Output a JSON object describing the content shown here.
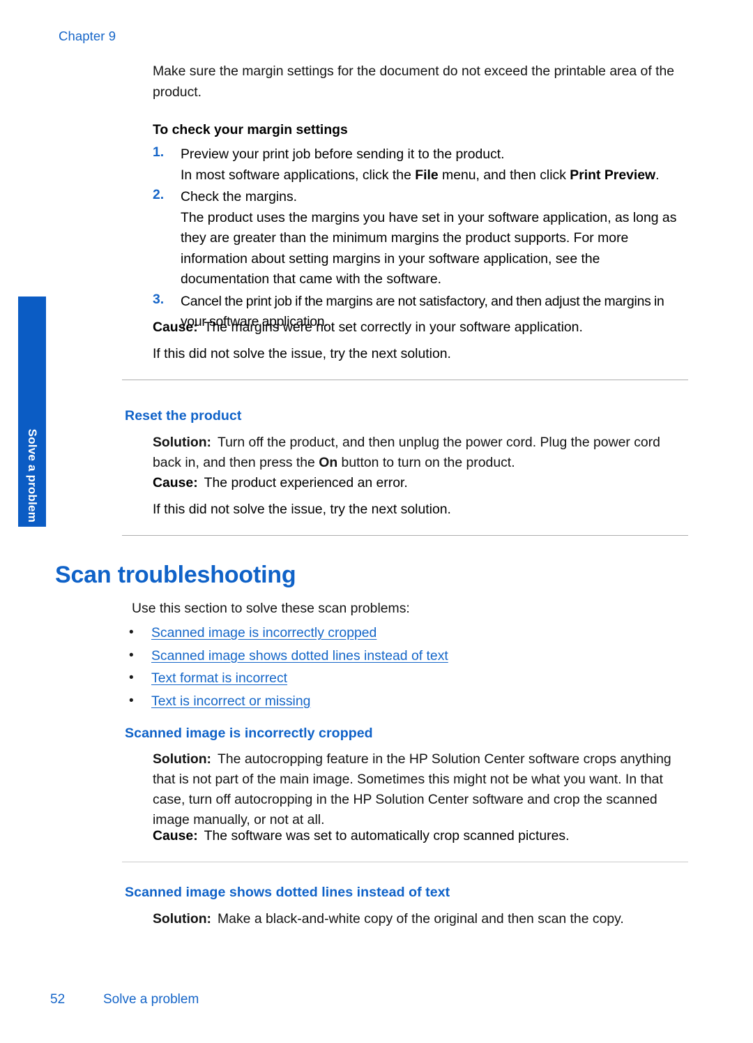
{
  "header": {
    "chapter_label": "Chapter 9"
  },
  "side_tab": {
    "label": "Solve a problem",
    "background_color": "#0B5CC4",
    "text_color": "#FFFFFF"
  },
  "colors": {
    "link_blue": "#1466C8",
    "heading_blue": "#0F62C8",
    "chapter_blue": "#1565C8",
    "rule_gray": "#ADADAD",
    "body_black": "#131313"
  },
  "content": {
    "intro_paragraph": "Make sure the margin settings for the document do not exceed the printable area of the product.",
    "procedure_heading": "To check your margin settings",
    "steps": [
      {
        "number": "1.",
        "lines": [
          {
            "type": "plain",
            "text": "Preview your print job before sending it to the product."
          },
          {
            "type": "rich",
            "parts": [
              {
                "text": "In most software applications, click the ",
                "bold": false
              },
              {
                "text": "File",
                "bold": true
              },
              {
                "text": " menu, and then click ",
                "bold": false
              },
              {
                "text": "Print Preview",
                "bold": true
              },
              {
                "text": ".",
                "bold": false
              }
            ]
          }
        ]
      },
      {
        "number": "2.",
        "lines": [
          {
            "type": "plain",
            "text": "Check the margins."
          },
          {
            "type": "plain",
            "text": "The product uses the margins you have set in your software application, as long as they are greater than the minimum margins the product supports. For more information about setting margins in your software application, see the documentation that came with the software."
          }
        ]
      },
      {
        "number": "3.",
        "lines": [
          {
            "type": "plain",
            "text": "Cancel the print job if the margins are not satisfactory, and then adjust the margins in your software application."
          }
        ]
      }
    ],
    "cause_1": {
      "label": "Cause:",
      "text": "The margins were not set correctly in your software application."
    },
    "next_solution_1": "If this did not solve the issue, try the next solution.",
    "reset_section": {
      "heading": "Reset the product",
      "solution_label": "Solution:",
      "solution_parts": [
        {
          "text": "Turn off the product, and then unplug the power cord. Plug the power cord back in, and then press the ",
          "bold": false
        },
        {
          "text": "On",
          "bold": true
        },
        {
          "text": " button to turn on the product.",
          "bold": false
        }
      ],
      "cause_label": "Cause:",
      "cause_text": "The product experienced an error.",
      "next_solution": "If this did not solve the issue, try the next solution."
    },
    "scan_section": {
      "title": "Scan troubleshooting",
      "intro": "Use this section to solve these scan problems:",
      "links": [
        "Scanned image is incorrectly cropped",
        "Scanned image shows dotted lines instead of text",
        "Text format is incorrect",
        "Text is incorrect or missing"
      ],
      "bullet_glyph": "•"
    },
    "cropped_section": {
      "heading": "Scanned image is incorrectly cropped",
      "solution_label": "Solution:",
      "solution_text": "The autocropping feature in the HP Solution Center software crops anything that is not part of the main image. Sometimes this might not be what you want. In that case, turn off autocropping in the HP Solution Center software and crop the scanned image manually, or not at all.",
      "cause_label": "Cause:",
      "cause_text": "The software was set to automatically crop scanned pictures."
    },
    "dotted_section": {
      "heading": "Scanned image shows dotted lines instead of text",
      "solution_label": "Solution:",
      "solution_text": "Make a black-and-white copy of the original and then scan the copy."
    }
  },
  "footer": {
    "page_number": "52",
    "section_name": "Solve a problem"
  }
}
